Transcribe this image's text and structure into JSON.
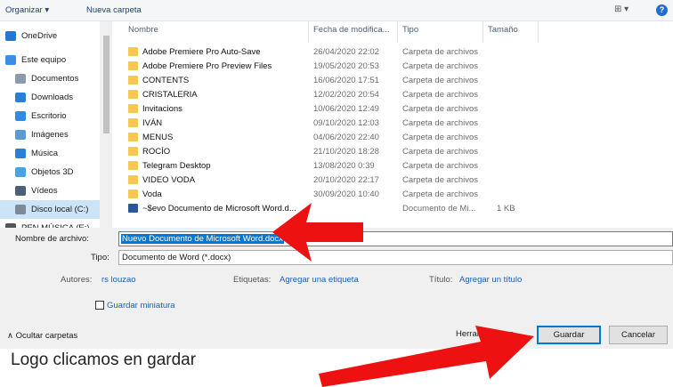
{
  "toolbar": {
    "organize_label": "Organizar ▾",
    "new_folder_label": "Nueva carpeta",
    "view_label": "⊞ ▾",
    "help_label": "?"
  },
  "nav": {
    "items": [
      {
        "label": "OneDrive",
        "icon": "cloud-icon",
        "color": "#1e79d6"
      },
      {
        "label": "Este equipo",
        "icon": "computer-icon",
        "color": "#3a8ee6"
      },
      {
        "label": "Documentos",
        "icon": "document-icon",
        "color": "#8a9bb0"
      },
      {
        "label": "Downloads",
        "icon": "download-icon",
        "color": "#2a7fd4"
      },
      {
        "label": "Escritorio",
        "icon": "desktop-icon",
        "color": "#2f8ae0"
      },
      {
        "label": "Imágenes",
        "icon": "pictures-icon",
        "color": "#5a9bd4"
      },
      {
        "label": "Música",
        "icon": "music-icon",
        "color": "#2a7fd4"
      },
      {
        "label": "Objetos 3D",
        "icon": "cube-icon",
        "color": "#4aa3df"
      },
      {
        "label": "Vídeos",
        "icon": "video-icon",
        "color": "#4a5f78"
      },
      {
        "label": "Disco local (C:)",
        "icon": "drive-icon",
        "color": "#7a8a99"
      },
      {
        "label": "PEN MÚSICA (E:)",
        "icon": "usb-drive-icon",
        "color": "#555555"
      }
    ]
  },
  "list": {
    "columns": {
      "name": "Nombre",
      "date": "Fecha de modifica...",
      "type": "Tipo",
      "size": "Tamaño"
    },
    "rows": [
      {
        "name": "Adobe Premiere Pro Auto-Save",
        "date": "26/04/2020 22:02",
        "type": "Carpeta de archivos",
        "size": ""
      },
      {
        "name": "Adobe Premiere Pro Preview Files",
        "date": "19/05/2020 20:53",
        "type": "Carpeta de archivos",
        "size": ""
      },
      {
        "name": "CONTENTS",
        "date": "16/06/2020 17:51",
        "type": "Carpeta de archivos",
        "size": ""
      },
      {
        "name": "CRISTALERIA",
        "date": "12/02/2020 20:54",
        "type": "Carpeta de archivos",
        "size": ""
      },
      {
        "name": "Invitacions",
        "date": "10/06/2020 12:49",
        "type": "Carpeta de archivos",
        "size": ""
      },
      {
        "name": "IVÁN",
        "date": "09/10/2020 12:03",
        "type": "Carpeta de archivos",
        "size": ""
      },
      {
        "name": "MENUS",
        "date": "04/06/2020 22:40",
        "type": "Carpeta de archivos",
        "size": ""
      },
      {
        "name": "ROCÍO",
        "date": "21/10/2020 18:28",
        "type": "Carpeta de archivos",
        "size": ""
      },
      {
        "name": "Telegram Desktop",
        "date": "13/08/2020 0:39",
        "type": "Carpeta de archivos",
        "size": ""
      },
      {
        "name": "VIDEO VODA",
        "date": "20/10/2020 22:17",
        "type": "Carpeta de archivos",
        "size": ""
      },
      {
        "name": "Voda",
        "date": "30/09/2020 10:40",
        "type": "Carpeta de archivos",
        "size": ""
      },
      {
        "name": "~$evo Documento de Microsoft Word.d...",
        "date": "",
        "type": "Documento de Mi...",
        "size": "1 KB"
      }
    ]
  },
  "form": {
    "filename_label": "Nombre de archivo:",
    "filename_value": "Nuevo Documento de Microsoft Word.docx",
    "type_label": "Tipo:",
    "type_value": "Documento de Word (*.docx)",
    "authors_label": "Autores:",
    "authors_value": "rs louzao",
    "tags_label": "Etiquetas:",
    "tags_value": "Agregar una etiqueta",
    "title_label": "Título:",
    "title_value": "Agregar un título",
    "thumbnail_label": "Guardar miniatura"
  },
  "footer": {
    "hide_folders_label": "∧ Ocultar carpetas",
    "tools_label": "Herramientas ▾",
    "save_label": "Guardar",
    "cancel_label": "Cancelar"
  },
  "caption": "Logo clicamos en gardar",
  "colors": {
    "arrow": "#ee1111",
    "accent": "#0078d7",
    "selection": "#cce4f7"
  }
}
